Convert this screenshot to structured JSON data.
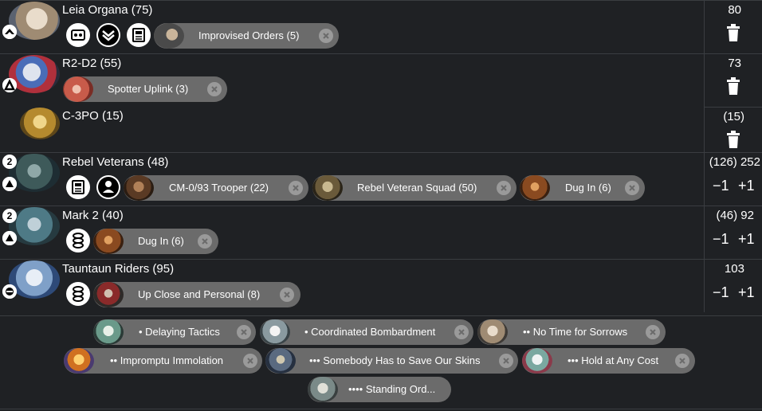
{
  "units": [
    {
      "title": "Leia Organa (75)",
      "points": "80",
      "chips": [
        {
          "label": "Improvised Orders (5)"
        }
      ]
    },
    {
      "title": "R2-D2 (55)",
      "points": "73",
      "chips": [
        {
          "label": "Spotter Uplink (3)"
        }
      ]
    },
    {
      "title": "C-3PO (15)",
      "points": "(15)"
    },
    {
      "title": "Rebel Veterans (48)",
      "count": "2",
      "points": "(126) 252",
      "minus": "−1",
      "plus": "+1",
      "chips": [
        {
          "label": "CM-0/93 Trooper (22)"
        },
        {
          "label": "Rebel Veteran Squad (50)"
        },
        {
          "label": "Dug In (6)"
        }
      ]
    },
    {
      "title": "Mark 2 (40)",
      "count": "2",
      "points": "(46) 92",
      "minus": "−1",
      "plus": "+1",
      "chips": [
        {
          "label": "Dug In (6)"
        }
      ]
    },
    {
      "title": "Tauntaun Riders (95)",
      "points": "103",
      "minus": "−1",
      "plus": "+1",
      "chips": [
        {
          "label": "Up Close and Personal (8)"
        }
      ]
    }
  ],
  "commands": [
    {
      "label": "• Delaying Tactics"
    },
    {
      "label": "• Coordinated Bombardment"
    },
    {
      "label": "•• No Time for Sorrows"
    },
    {
      "label": "•• Impromptu Immolation"
    },
    {
      "label": "••• Somebody Has to Save Our Skins"
    },
    {
      "label": "••• Hold at Any Cost"
    },
    {
      "label": "•••• Standing Ord..."
    }
  ],
  "colors": {
    "background": "#1f2124",
    "chip": "#6b6b6b",
    "divider": "#3a3d41"
  }
}
